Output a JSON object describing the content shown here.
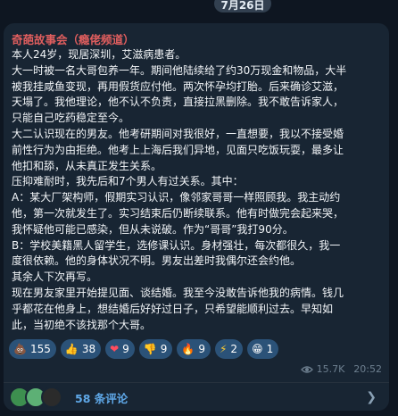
{
  "date_label": "7月26日",
  "message": {
    "channel_name": "奇葩故事会（瘾佬频道）",
    "lines": [
      "本人24岁，现居深圳，艾滋病患者。",
      "大一时被一名大哥包养一年。期间他陆续给了约30万现金和物品，大半",
      "被我挂咸鱼变现，再用假货应付他。两次怀孕均打胎。后来确诊艾滋，",
      "天塌了。我他理论，他不认不负责，直接拉黑删除。我不敢告诉家人，",
      "只能自己吃药稳定至今。",
      "大二认识现在的男友。他考研期间对我很好，一直想要，我以不接受婚",
      "前性行为为由拒绝。他考上上海后我们异地，见面只吃饭玩耍，最多让",
      "他扣和舔，从未真正发生关系。",
      "压抑难耐时，我先后和7个男人有过关系。其中：",
      "A：某大厂架构师，假期实习认识，像邻家哥哥一样照顾我。我主动约",
      "他，第一次就发生了。实习结束后仍断续联系。他有时做完会起来哭，",
      "我怀疑他可能已感染，但从未说破。作为“哥哥”我打90分。",
      "B：学校美籍黑人留学生，选修课认识。身材强壮，每次都很久，我一",
      "度很依赖。他的身体状况不明。男友出差时我偶尔还会约他。",
      "其余人下次再写。",
      "现在男友家里开始提见面、谈结婚。我至今没敢告诉他我的病情。钱几",
      "乎都花在他身上，想结婚后好好过日子，只希望能顺利过去。早知如",
      "此，当初绝不该找那个大哥。"
    ],
    "reactions": [
      {
        "icon": "poop-emoji",
        "glyph": "💩",
        "count": "155"
      },
      {
        "icon": "thumbs-up-emoji",
        "glyph": "👍",
        "count": "38"
      },
      {
        "icon": "heart-emoji",
        "glyph": "❤",
        "count": "9"
      },
      {
        "icon": "thumbs-down-emoji",
        "glyph": "👎",
        "count": "9"
      },
      {
        "icon": "fire-emoji",
        "glyph": "🔥",
        "count": "9"
      },
      {
        "icon": "lightning-emoji",
        "glyph": "⚡",
        "count": "2"
      },
      {
        "icon": "grin-emoji",
        "glyph": "😁",
        "count": "1"
      }
    ],
    "views": "15.7K",
    "time": "20:52",
    "comments_label": "58 条评论"
  },
  "colors": {
    "background": "#0e1621",
    "bubble": "#182533",
    "channel_name": "#e05e5e",
    "reaction_pill": "#2b5278",
    "link": "#5fa8e8"
  }
}
